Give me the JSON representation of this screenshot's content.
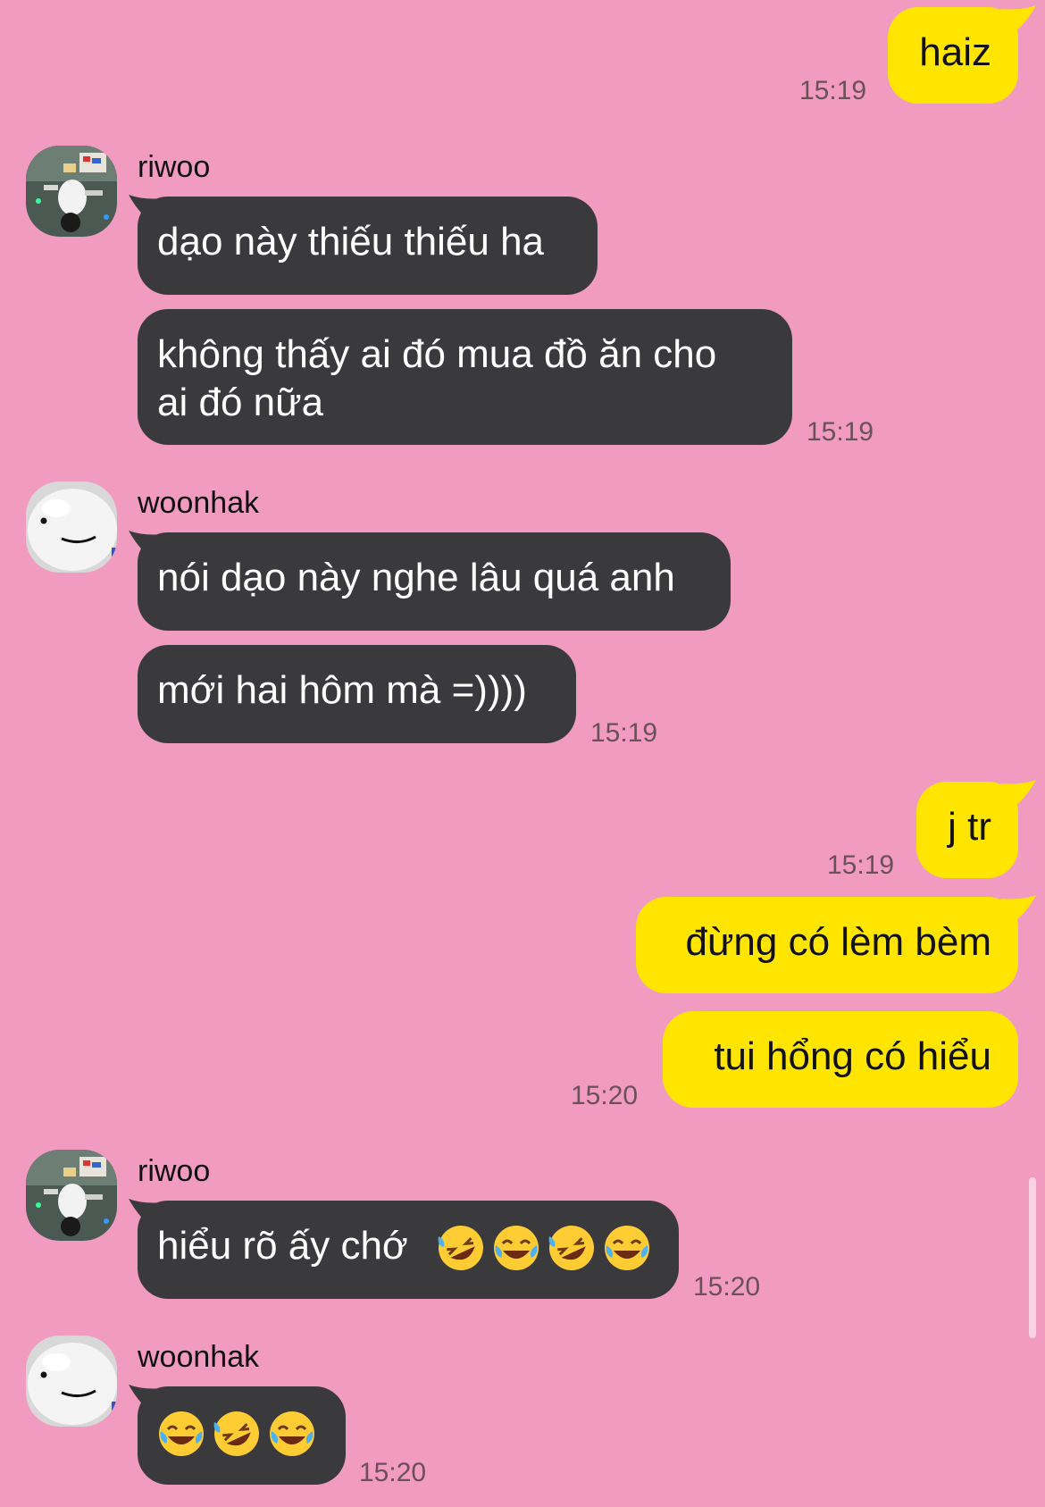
{
  "colors": {
    "background": "#f29bc0",
    "incoming_bubble": "#3a3a3c",
    "outgoing_bubble": "#ffe500",
    "time_text": "#6a5058"
  },
  "messages": {
    "m1": {
      "text": "haiz",
      "time": "15:19"
    },
    "g1": {
      "sender": "riwoo",
      "avatar": "riwoo-photo-avatar",
      "b1": "dạo này thiếu thiếu ha",
      "b2_line1": "không thấy ai đó mua đồ ăn cho",
      "b2_line2": "ai đó nữa",
      "time": "15:19"
    },
    "g2": {
      "sender": "woonhak",
      "avatar": "white-blob-face-avatar",
      "b1": "nói dạo này nghe lâu quá anh",
      "b2": "mới hai hôm mà =))))",
      "time": "15:19"
    },
    "m3": {
      "text": "j tr",
      "time": "15:19"
    },
    "m4": {
      "b1": "đừng có lèm bèm",
      "b2": "tui hổng có hiểu",
      "time": "15:20"
    },
    "g3": {
      "sender": "riwoo",
      "avatar": "riwoo-photo-avatar",
      "b1": "hiểu rõ ấy chớ",
      "emojis": [
        "rofl-emoji",
        "tears-of-joy-emoji",
        "rofl-emoji",
        "tears-of-joy-emoji"
      ],
      "time": "15:20"
    },
    "g4": {
      "sender": "woonhak",
      "avatar": "white-blob-face-avatar",
      "emojis": [
        "tears-of-joy-emoji",
        "rofl-emoji",
        "tears-of-joy-emoji"
      ],
      "time": "15:20"
    }
  }
}
